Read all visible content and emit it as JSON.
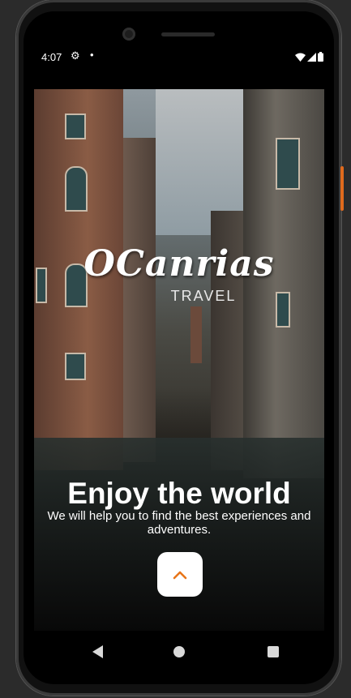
{
  "status_bar": {
    "time": "4:07",
    "icons": [
      "gear-icon",
      "notification-dot-icon",
      "wifi-icon",
      "signal-icon",
      "battery-icon"
    ]
  },
  "hero": {
    "brand": "OCanrias",
    "brand_subtitle": "TRAVEL",
    "headline": "Enjoy the world",
    "description": "We will help you to find the best experiences and adventures."
  },
  "actions": {
    "up_button_icon": "chevron-up-icon"
  },
  "colors": {
    "accent": "#e8751a",
    "button_bg": "#ffffff",
    "text": "#ffffff"
  },
  "navigation": {
    "buttons": [
      "back",
      "home",
      "recents"
    ]
  }
}
